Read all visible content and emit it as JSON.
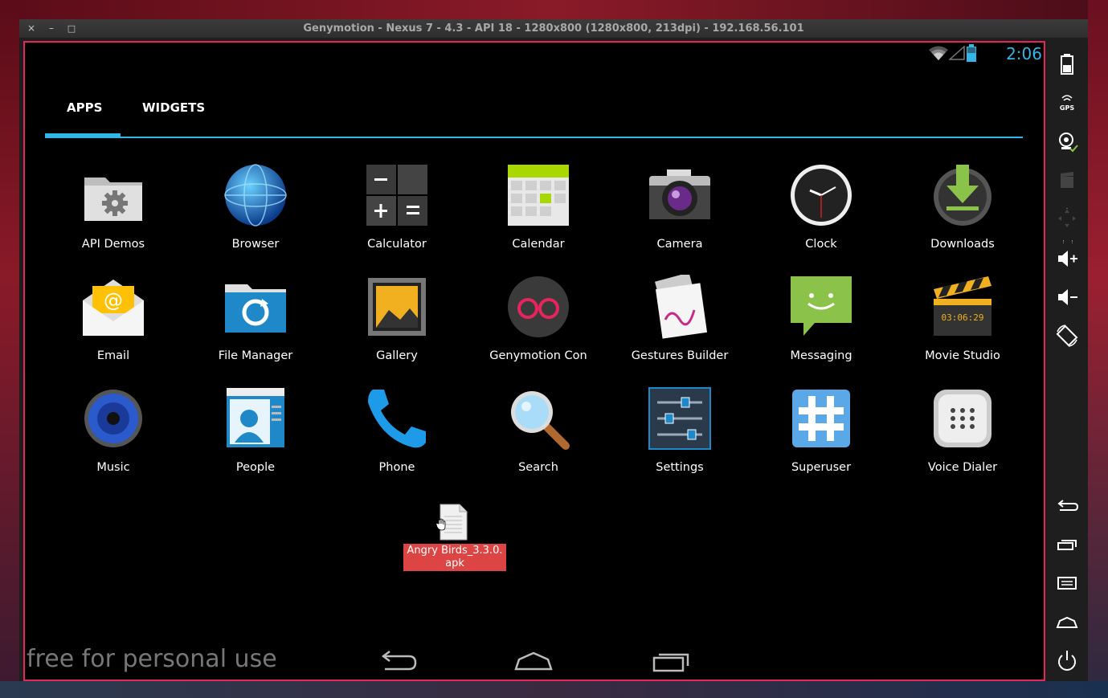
{
  "window": {
    "title": "Genymotion - Nexus 7 - 4.3 - API 18 - 1280x800 (1280x800, 213dpi) - 192.168.56.101",
    "close_glyph": "×",
    "minimize_glyph": "–",
    "maximize_glyph": "□"
  },
  "status_bar": {
    "time": "2:06",
    "accent_color": "#33b5e5"
  },
  "tabs": [
    {
      "label": "APPS",
      "selected": true
    },
    {
      "label": "WIDGETS",
      "selected": false
    }
  ],
  "apps": [
    {
      "label": "API Demos",
      "icon": "folder-gear-icon"
    },
    {
      "label": "Browser",
      "icon": "globe-icon"
    },
    {
      "label": "Calculator",
      "icon": "calculator-icon"
    },
    {
      "label": "Calendar",
      "icon": "calendar-icon"
    },
    {
      "label": "Camera",
      "icon": "camera-icon"
    },
    {
      "label": "Clock",
      "icon": "clock-icon"
    },
    {
      "label": "Downloads",
      "icon": "download-icon"
    },
    {
      "label": "Email",
      "icon": "envelope-icon"
    },
    {
      "label": "File Manager",
      "icon": "folder-refresh-icon"
    },
    {
      "label": "Gallery",
      "icon": "picture-frame-icon"
    },
    {
      "label": "Genymotion Con",
      "icon": "genymotion-icon"
    },
    {
      "label": "Gestures Builder",
      "icon": "gestures-icon"
    },
    {
      "label": "Messaging",
      "icon": "message-bubble-icon"
    },
    {
      "label": "Movie Studio",
      "icon": "clapperboard-icon"
    },
    {
      "label": "Music",
      "icon": "speaker-icon"
    },
    {
      "label": "People",
      "icon": "contacts-icon"
    },
    {
      "label": "Phone",
      "icon": "phone-handset-icon"
    },
    {
      "label": "Search",
      "icon": "magnifier-icon"
    },
    {
      "label": "Settings",
      "icon": "sliders-icon"
    },
    {
      "label": "Superuser",
      "icon": "hash-icon"
    },
    {
      "label": "Voice Dialer",
      "icon": "voice-dialer-icon"
    }
  ],
  "dragged_file": {
    "label": "Angry Birds_3.3.0.\napk",
    "label_line1": "Angry Birds_3.3.0.",
    "label_line2": "apk"
  },
  "watermark": "free for personal use",
  "sidebar_icons": [
    "battery-icon",
    "gps-icon",
    "webcam-icon",
    "clapper-icon",
    "dpad-icon",
    "volume-up-icon",
    "volume-down-icon",
    "rotate-icon",
    "back-icon",
    "recent-apps-icon",
    "menu-icon",
    "home-icon",
    "power-icon"
  ]
}
